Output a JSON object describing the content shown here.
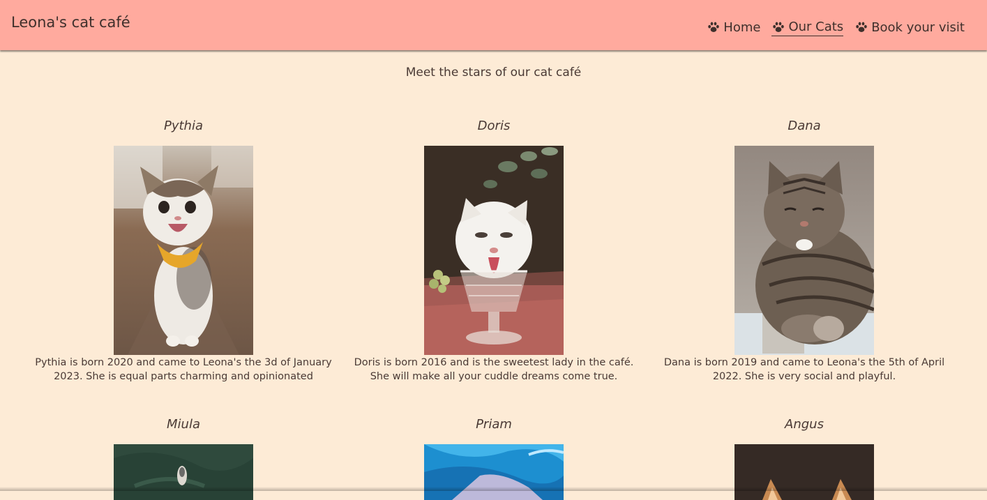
{
  "brand": "Leona's cat café",
  "nav": {
    "items": [
      {
        "label": "Home",
        "icon": "paw-icon",
        "active": false
      },
      {
        "label": "Our Cats",
        "icon": "paw-icon",
        "active": true
      },
      {
        "label": "Book your visit",
        "icon": "paw-icon",
        "active": false
      }
    ]
  },
  "page": {
    "heading": "Meet the stars of our cat café"
  },
  "cats": [
    {
      "name": "Pythia",
      "description": "Pythia is born 2020 and came to Leona's the 3d of January 2023. She is equal parts charming and opinionated",
      "photo": "photo of tabby-and-white cat wearing a yellow bandana"
    },
    {
      "name": "Doris",
      "description": "Doris is born 2016 and is the sweetest lady in the café. She will make all your cuddle dreams come true.",
      "photo": "photo of white cat drinking from a crystal glass"
    },
    {
      "name": "Dana",
      "description": "Dana is born 2019 and came to Leona's the 5th of April 2022. She is very social and playful.",
      "photo": "photo of tabby cat with paws on a white surface"
    },
    {
      "name": "Miula",
      "description": "",
      "photo": "photo of cat on green sofa"
    },
    {
      "name": "Priam",
      "description": "",
      "photo": "photo with blue textured background"
    },
    {
      "name": "Angus",
      "description": "",
      "photo": "photo of orange cat on dark background"
    }
  ],
  "colors": {
    "header_bg": "#ffaa9e",
    "page_bg": "#fdebd6",
    "text": "#4a3a35"
  }
}
